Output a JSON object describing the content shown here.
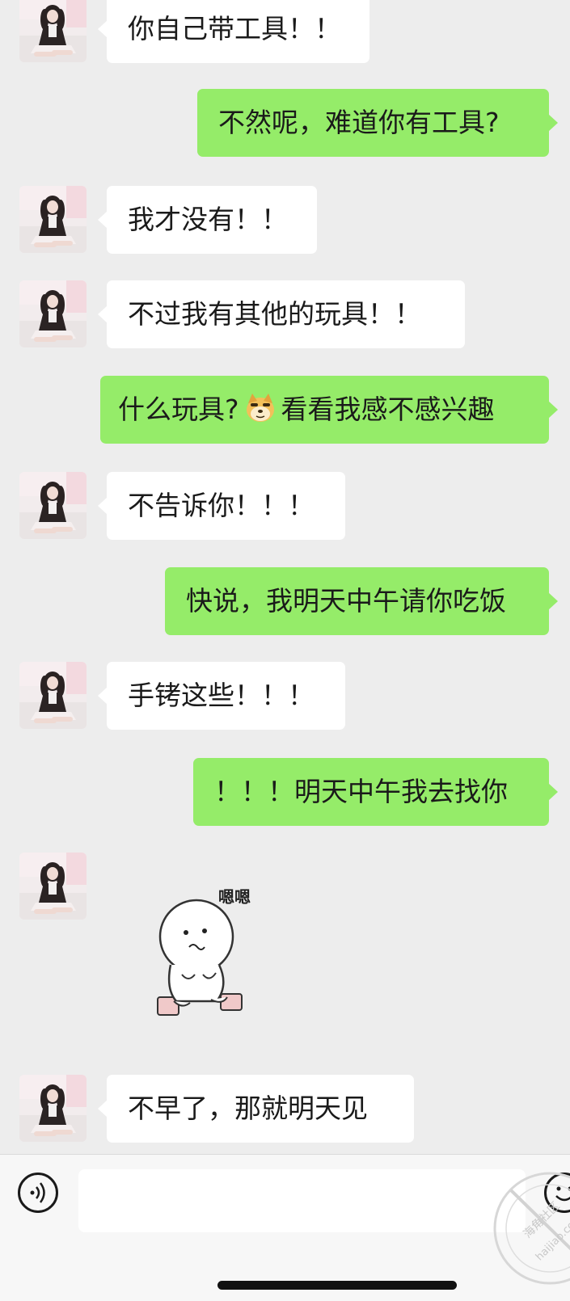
{
  "conversation": {
    "messages": [
      {
        "side": "in",
        "text": "你自己带工具！！"
      },
      {
        "side": "out",
        "text": "不然呢，难道你有工具?"
      },
      {
        "side": "in",
        "text": "我才没有！！"
      },
      {
        "side": "in",
        "text": "不过我有其他的玩具！！"
      },
      {
        "side": "out",
        "text_before_emoji": "什么玩具?",
        "emoji": "doge-emoji",
        "text_after_emoji": "看看我感不感兴趣"
      },
      {
        "side": "in",
        "text": "不告诉你！！！"
      },
      {
        "side": "out",
        "text": "快说，我明天中午请你吃饭"
      },
      {
        "side": "in",
        "text": "手铐这些！！！"
      },
      {
        "side": "out",
        "text": "！！！明天中午我去找你"
      },
      {
        "side": "in",
        "sticker": "sitting-blob-sticker",
        "sticker_caption": "嗯嗯"
      },
      {
        "side": "in",
        "text": "不早了，那就明天见"
      }
    ]
  },
  "input_bar": {
    "voice_icon": "voice-icon",
    "emoji_icon": "emoji-face-icon",
    "input_value": ""
  },
  "watermark": {
    "text_cn": "海角社区",
    "text_url": "haijiao.com"
  },
  "colors": {
    "background": "#ededed",
    "incoming_bubble": "#ffffff",
    "outgoing_bubble": "#95ec69",
    "text": "#1a1a1a"
  }
}
